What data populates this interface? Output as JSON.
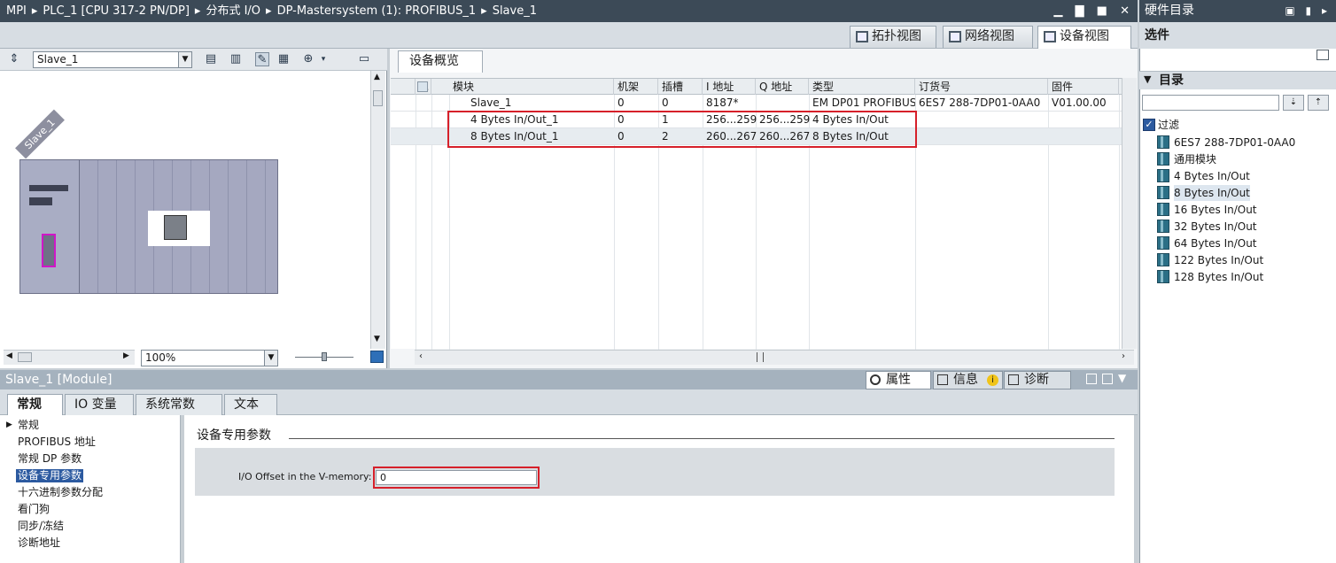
{
  "titlebar": {
    "crumbs": [
      "MPI",
      "PLC_1 [CPU 317-2 PN/DP]",
      "分布式 I/O",
      "DP-Mastersystem (1): PROFIBUS_1",
      "Slave_1"
    ],
    "sep": "▸",
    "win_controls": "▁ ▇ ■ ✕"
  },
  "catalog_title": {
    "title": "硬件目录",
    "btns": "▣ ▮ ▸"
  },
  "view_tabs": [
    "拓扑视图",
    "网络视图",
    "设备视图"
  ],
  "left_toolbar": {
    "device_combo": "Slave_1",
    "zoom_combo": "100%"
  },
  "rack": {
    "label": "Slave_1"
  },
  "overview": {
    "tab": "设备概览",
    "headers": [
      "模块",
      "机架",
      "插槽",
      "I 地址",
      "Q 地址",
      "类型",
      "订货号",
      "固件"
    ],
    "head_extra": "...",
    "rows": [
      {
        "module": "Slave_1",
        "rack": "0",
        "slot": "0",
        "i": "8187*",
        "q": "",
        "type": "EM DP01 PROFIBUS...",
        "order": "6ES7 288-7DP01-0AA0",
        "fw": "V01.00.00"
      },
      {
        "module": "4 Bytes In/Out_1",
        "rack": "0",
        "slot": "1",
        "i": "256...259",
        "q": "256...259",
        "type": "4 Bytes In/Out",
        "order": "",
        "fw": ""
      },
      {
        "module": "8 Bytes In/Out_1",
        "rack": "0",
        "slot": "2",
        "i": "260...267",
        "q": "260...267",
        "type": "8 Bytes In/Out",
        "order": "",
        "fw": ""
      }
    ]
  },
  "inspector": {
    "title": "Slave_1 [Module]",
    "right_tabs": [
      "属性",
      "信息",
      "诊断"
    ],
    "info_badge": "i",
    "sub_tabs": [
      "常规",
      "IO 变量",
      "系统常数",
      "文本"
    ],
    "nav": [
      "常规",
      "PROFIBUS 地址",
      "常规 DP 参数",
      "设备专用参数",
      "十六进制参数分配",
      "看门狗",
      "同步/冻结",
      "诊断地址"
    ],
    "section_title": "设备专用参数",
    "param_label": "I/O Offset in the V-memory:",
    "param_value": "0"
  },
  "catalog": {
    "options": "选件",
    "directory": "目录",
    "filter": "过滤",
    "items": [
      "6ES7 288-7DP01-0AA0",
      "通用模块",
      "4 Bytes In/Out",
      "8 Bytes In/Out",
      "16 Bytes In/Out",
      "32 Bytes In/Out",
      "64 Bytes In/Out",
      "122 Bytes In/Out",
      "128 Bytes In/Out"
    ],
    "selected_item": "8 Bytes In/Out"
  },
  "colors": {
    "titlebar": "#3c4a57",
    "highlight": "#d6202a",
    "selected_nav": "#2c5aa0",
    "rack": "#a5a8c0"
  }
}
